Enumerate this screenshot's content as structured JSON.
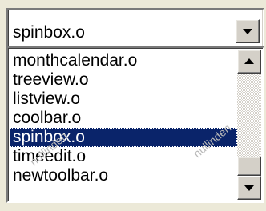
{
  "combo": {
    "value": "spinbox.o",
    "button_icon": "chevron-down-icon"
  },
  "list": {
    "items": [
      {
        "label": "monthcalendar.o",
        "selected": false
      },
      {
        "label": "treeview.o",
        "selected": false
      },
      {
        "label": "listview.o",
        "selected": false
      },
      {
        "label": "coolbar.o",
        "selected": false
      },
      {
        "label": "spinbox.o",
        "selected": true
      },
      {
        "label": "timeedit.o",
        "selected": false
      },
      {
        "label": "newtoolbar.o",
        "selected": false
      }
    ],
    "scroll_up_icon": "arrow-up-icon",
    "scroll_down_icon": "arrow-down-icon"
  },
  "watermarks": [
    "nullinden",
    "nullinden"
  ],
  "colors": {
    "selection_background": "#0a246a",
    "selection_text": "#ffffff",
    "face": "#d4d0c8"
  }
}
